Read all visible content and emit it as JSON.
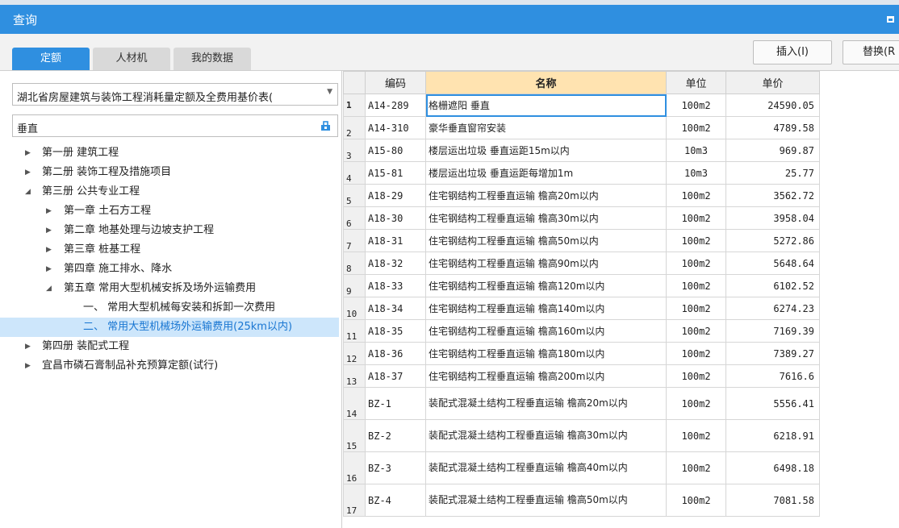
{
  "window": {
    "title": "查询"
  },
  "tabs": [
    {
      "label": "定额"
    },
    {
      "label": "人材机"
    },
    {
      "label": "我的数据"
    }
  ],
  "actions": {
    "insert": "插入(I)",
    "replace": "替换(R"
  },
  "library_select": {
    "value": "湖北省房屋建筑与装饰工程消耗量定额及全费用基价表("
  },
  "search": {
    "value": "垂直"
  },
  "tree": [
    {
      "label": "第一册 建筑工程"
    },
    {
      "label": "第二册 装饰工程及措施项目"
    },
    {
      "label": "第三册 公共专业工程"
    },
    {
      "label": "第一章 土石方工程"
    },
    {
      "label": "第二章 地基处理与边坡支护工程"
    },
    {
      "label": "第三章 桩基工程"
    },
    {
      "label": "第四章 施工排水、降水"
    },
    {
      "label": "第五章 常用大型机械安拆及场外运输费用"
    },
    {
      "label": "一、 常用大型机械每安装和拆卸一次费用"
    },
    {
      "label": "二、 常用大型机械场外运输费用(25km以内)"
    },
    {
      "label": "第四册 装配式工程"
    },
    {
      "label": "宜昌市磷石膏制品补充预算定额(试行)"
    }
  ],
  "grid": {
    "headers": {
      "code": "编码",
      "name": "名称",
      "unit": "单位",
      "price": "单价"
    },
    "rows": [
      {
        "idx": "1",
        "code": "A14-289",
        "name": "格栅遮阳 垂直",
        "unit": "100m2",
        "price": "24590.05"
      },
      {
        "idx": "2",
        "code": "A14-310",
        "name": "豪华垂直窗帘安装",
        "unit": "100m2",
        "price": "4789.58"
      },
      {
        "idx": "3",
        "code": "A15-80",
        "name": "楼层运出垃圾 垂直运距15m以内",
        "unit": "10m3",
        "price": "969.87"
      },
      {
        "idx": "4",
        "code": "A15-81",
        "name": "楼层运出垃圾 垂直运距每增加1m",
        "unit": "10m3",
        "price": "25.77"
      },
      {
        "idx": "5",
        "code": "A18-29",
        "name": "住宅钢结构工程垂直运输 檐高20m以内",
        "unit": "100m2",
        "price": "3562.72"
      },
      {
        "idx": "6",
        "code": "A18-30",
        "name": "住宅钢结构工程垂直运输 檐高30m以内",
        "unit": "100m2",
        "price": "3958.04"
      },
      {
        "idx": "7",
        "code": "A18-31",
        "name": "住宅钢结构工程垂直运输 檐高50m以内",
        "unit": "100m2",
        "price": "5272.86"
      },
      {
        "idx": "8",
        "code": "A18-32",
        "name": "住宅钢结构工程垂直运输 檐高90m以内",
        "unit": "100m2",
        "price": "5648.64"
      },
      {
        "idx": "9",
        "code": "A18-33",
        "name": "住宅钢结构工程垂直运输 檐高120m以内",
        "unit": "100m2",
        "price": "6102.52"
      },
      {
        "idx": "10",
        "code": "A18-34",
        "name": "住宅钢结构工程垂直运输 檐高140m以内",
        "unit": "100m2",
        "price": "6274.23"
      },
      {
        "idx": "11",
        "code": "A18-35",
        "name": "住宅钢结构工程垂直运输 檐高160m以内",
        "unit": "100m2",
        "price": "7169.39"
      },
      {
        "idx": "12",
        "code": "A18-36",
        "name": "住宅钢结构工程垂直运输 檐高180m以内",
        "unit": "100m2",
        "price": "7389.27"
      },
      {
        "idx": "13",
        "code": "A18-37",
        "name": "住宅钢结构工程垂直运输 檐高200m以内",
        "unit": "100m2",
        "price": "7616.6"
      },
      {
        "idx": "14",
        "code": "BZ-1",
        "name": "装配式混凝土结构工程垂直运输 檐高20m以内",
        "unit": "100m2",
        "price": "5556.41"
      },
      {
        "idx": "15",
        "code": "BZ-2",
        "name": "装配式混凝土结构工程垂直运输 檐高30m以内",
        "unit": "100m2",
        "price": "6218.91"
      },
      {
        "idx": "16",
        "code": "BZ-3",
        "name": "装配式混凝土结构工程垂直运输 檐高40m以内",
        "unit": "100m2",
        "price": "6498.18"
      },
      {
        "idx": "17",
        "code": "BZ-4",
        "name": "装配式混凝土结构工程垂直运输 檐高50m以内",
        "unit": "100m2",
        "price": "7081.58"
      }
    ]
  }
}
